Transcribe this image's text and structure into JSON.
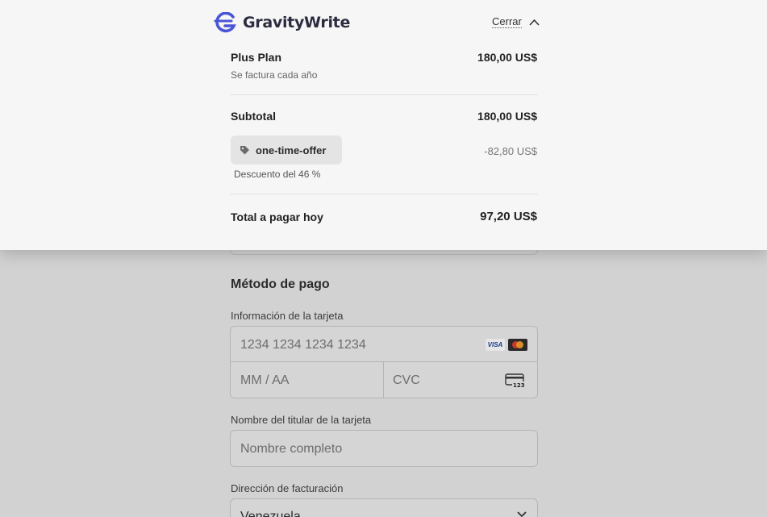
{
  "header": {
    "brand_name": "GravityWrite",
    "close_label": "Cerrar",
    "brand_color": "#4a55d6"
  },
  "summary": {
    "plan_name": "Plus Plan",
    "plan_billing": "Se factura cada año",
    "plan_price": "180,00 US$",
    "subtotal_label": "Subtotal",
    "subtotal_amount": "180,00 US$",
    "promo_code": "one-time-offer",
    "discount_amount": "-82,80 US$",
    "discount_description": "Descuento del 46 %",
    "total_label": "Total a pagar hoy",
    "total_amount": "97,20 US$"
  },
  "payment": {
    "section_title": "Método de pago",
    "card_info_label": "Información de la tarjeta",
    "card_number_placeholder": "1234 1234 1234 1234",
    "card_brand_visa": "VISA",
    "expiry_placeholder": "MM / AA",
    "cvc_placeholder": "CVC",
    "cvc_icon_text": "123",
    "cardholder_label": "Nombre del titular de la tarjeta",
    "cardholder_placeholder": "Nombre completo",
    "billing_address_label": "Dirección de facturación",
    "country_value": "Venezuela"
  },
  "icons": {
    "logo": "gravitywrite-logo-icon",
    "close": "chevron-up-icon",
    "promo": "tag-icon",
    "cvc": "credit-card-cvc-icon",
    "select": "chevron-down-icon"
  }
}
